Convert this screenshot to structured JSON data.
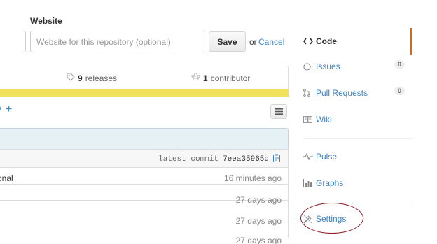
{
  "form": {
    "website_label": "Website",
    "website_placeholder": "Website for this repository (optional)",
    "save_label": "Save",
    "or_text": "or",
    "cancel_label": "Cancel"
  },
  "stats": {
    "releases_count": "9",
    "releases_label": "releases",
    "contributors_count": "1",
    "contributors_label": "contributor",
    "language_color": "#f1e05a"
  },
  "branch": {
    "fragment": "/",
    "plus_label": "+"
  },
  "commit": {
    "latest_label": "latest commit",
    "sha": "7eea35965d"
  },
  "files": [
    {
      "name": "onal",
      "age": "16 minutes ago"
    },
    {
      "name": "",
      "age": "27 days ago"
    },
    {
      "name": "",
      "age": "27 days ago"
    },
    {
      "name": "",
      "age": "27 days ago"
    }
  ],
  "sidebar": {
    "accent_color": "#d26911",
    "items": [
      {
        "label": "Code",
        "icon": "code-icon"
      },
      {
        "label": "Issues",
        "icon": "issue-icon",
        "count": "0"
      },
      {
        "label": "Pull Requests",
        "icon": "pull-request-icon",
        "count": "0"
      },
      {
        "label": "Wiki",
        "icon": "book-icon"
      },
      {
        "label": "Pulse",
        "icon": "pulse-icon"
      },
      {
        "label": "Graphs",
        "icon": "graph-icon"
      },
      {
        "label": "Settings",
        "icon": "tools-icon"
      }
    ]
  }
}
